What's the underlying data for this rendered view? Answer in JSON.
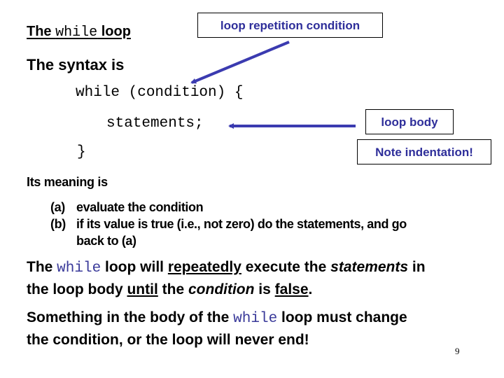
{
  "title": {
    "prefix": "The ",
    "keyword": "while",
    "suffix": " loop"
  },
  "callouts": {
    "condition": "loop repetition condition",
    "body": "loop body",
    "indentation": "Note indentation!"
  },
  "syntax": {
    "intro": "The syntax is",
    "code_lines": [
      "while (condition) {",
      "statements;",
      "}"
    ]
  },
  "meaning": {
    "intro": "Its meaning is",
    "steps": [
      {
        "label": "(a)",
        "text": "evaluate the condition"
      },
      {
        "label": "(b)",
        "text": "if its value is true (i.e., not zero) do the statements, and go",
        "continuation": "back to (a)"
      }
    ]
  },
  "paragraph1": {
    "part1": "The ",
    "keyword": "while",
    "part2": " loop will ",
    "underlined1": "repeatedly",
    "part3": " execute the ",
    "italic1": "statements",
    "part4": " in",
    "line2_part1": "the loop body ",
    "underlined2": "until",
    "line2_part2": " the ",
    "italic2": "condition",
    "line2_part3": " is ",
    "underlined3": "false",
    "line2_part4": "."
  },
  "paragraph2": {
    "part1": "Something in the body of the ",
    "keyword": "while",
    "part2": " loop must change",
    "line2": "the condition, or the loop will never end!"
  },
  "page_number": "9",
  "colors": {
    "callout_text": "#2e2e9a",
    "arrow": "#3b3bb0",
    "code_keyword": "#3a3a9a"
  }
}
